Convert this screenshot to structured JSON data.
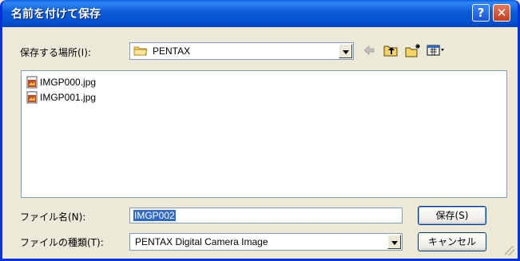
{
  "window": {
    "title": "名前を付けて保存"
  },
  "titlebar_buttons": {
    "help": "?",
    "close": "✕"
  },
  "save_location": {
    "label": "保存する場所(I):",
    "value": "PENTAX",
    "icon": "folder-icon"
  },
  "toolbar": {
    "back_icon": "back-arrow-icon",
    "up_icon": "up-one-level-icon",
    "new_folder_icon": "new-folder-icon",
    "view_menu_icon": "view-menu-icon"
  },
  "files": [
    {
      "name": "IMGP000.jpg",
      "icon": "jpeg-file-icon"
    },
    {
      "name": "IMGP001.jpg",
      "icon": "jpeg-file-icon"
    }
  ],
  "file_name": {
    "label": "ファイル名(N):",
    "value": "IMGP002"
  },
  "file_type": {
    "label": "ファイルの種類(T):",
    "value": "PENTAX Digital Camera Image"
  },
  "buttons": {
    "save": "保存(S)",
    "cancel": "キャンセル"
  },
  "colors": {
    "titlebar": "#0b5bd8",
    "dialog_bg": "#ece9d8",
    "selection": "#316ac5"
  }
}
